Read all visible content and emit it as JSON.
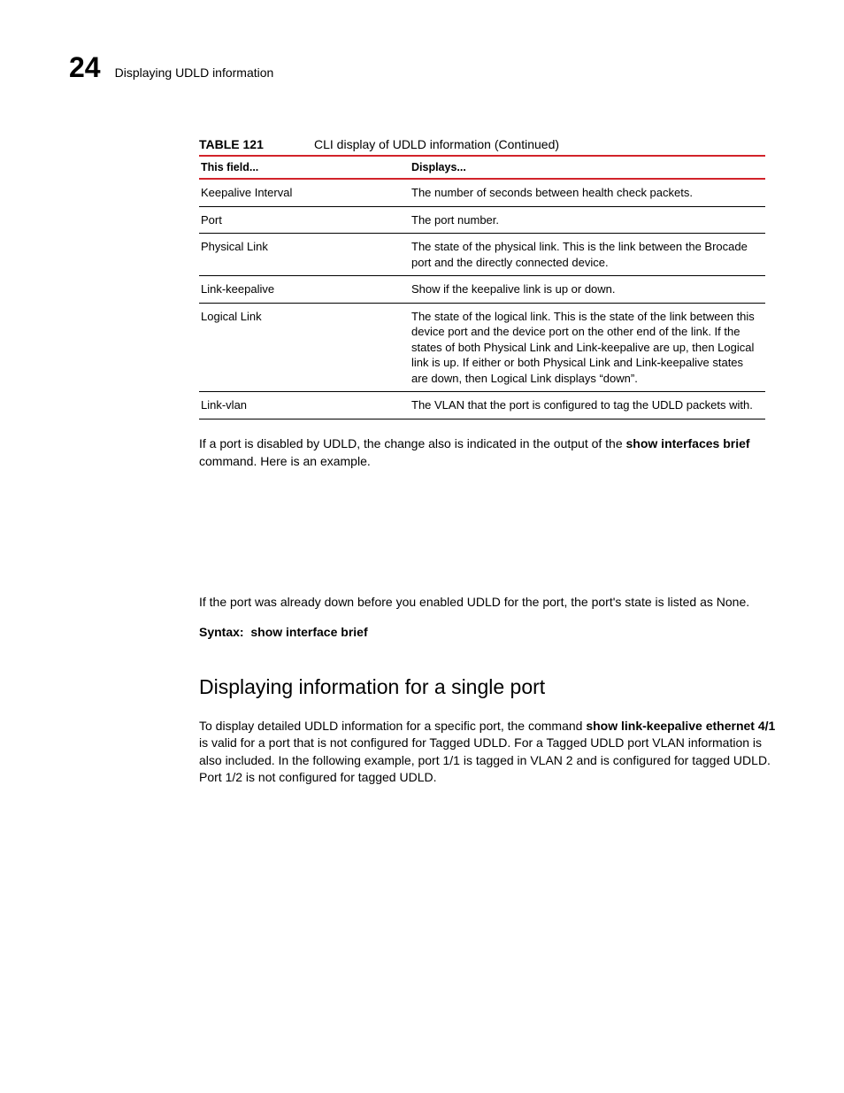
{
  "header": {
    "chapter_number": "24",
    "title": "Displaying UDLD information"
  },
  "table": {
    "label": "TABLE 121",
    "caption": "CLI display of UDLD information  (Continued)",
    "head_field": "This field...",
    "head_displays": "Displays...",
    "rows": [
      {
        "field": "Keepalive Interval",
        "desc": "The number of seconds between health check packets."
      },
      {
        "field": "Port",
        "desc": "The port number."
      },
      {
        "field": "Physical Link",
        "desc": "The state of the physical link. This is the link between the Brocade port and the directly connected device."
      },
      {
        "field": "Link-keepalive",
        "desc": "Show if the keepalive link is up or down."
      },
      {
        "field": "Logical Link",
        "desc": "The state of the logical link. This is the state of the link between this device port and the device port on the other end of the link. If the states of both Physical Link and Link-keepalive are up, then Logical link is up. If either or both Physical Link and Link-keepalive states are down, then Logical Link displays “down”."
      },
      {
        "field": "Link-vlan",
        "desc": "The VLAN that the port is configured to tag the UDLD packets with."
      }
    ]
  },
  "body": {
    "p1_pre": "If a port is disabled by UDLD, the change also is indicated in the output of the ",
    "p1_cmd": "show interfaces brief",
    "p1_post": " command. Here is an example.",
    "p2": "If the port was already down before you enabled UDLD for the port, the port's state is listed as None.",
    "syntax": "Syntax:  show interface brief",
    "heading": "Displaying information for a single port",
    "p3_pre": "To display detailed UDLD information for a specific port, the command ",
    "p3_cmd1": "show link-keepalive ethernet 4/1",
    "p3_mid": " is valid for a port that is not configured for Tagged UDLD. For a Tagged UDLD port VLAN information is also included. In the following example, port 1/1 is tagged in VLAN 2 and is configured for tagged UDLD. Port 1/2 is not configured for tagged UDLD."
  }
}
